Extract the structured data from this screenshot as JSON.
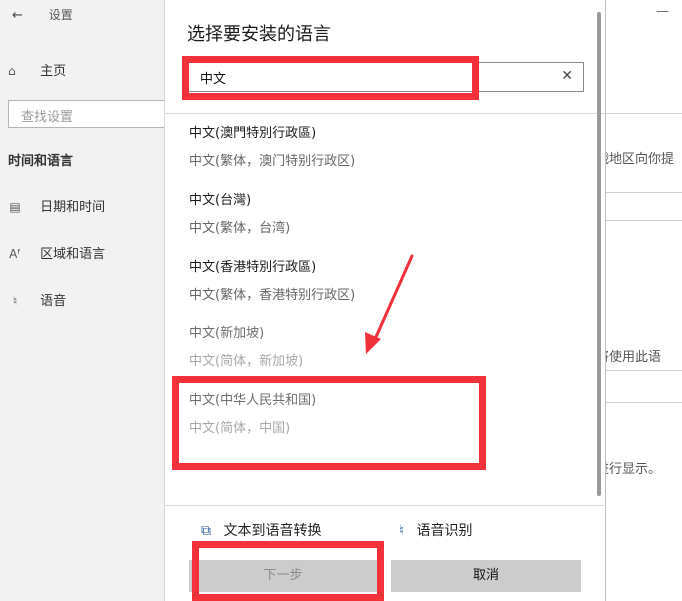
{
  "settings": {
    "back_glyph": "←",
    "title": "设置",
    "home_label": "主页",
    "search_placeholder": "查找设置",
    "section_title": "时间和语言",
    "items": [
      {
        "label": "日期和时间"
      },
      {
        "label": "区域和语言"
      },
      {
        "label": "语音"
      }
    ]
  },
  "background": {
    "fragment_1": "战地区向你提",
    "fragment_2": "将使用此语",
    "fragment_3": "进行显示。",
    "minimize_glyph": "—"
  },
  "dialog": {
    "title": "选择要安装的语言",
    "search_value": "中文",
    "clear_glyph": "✕",
    "languages": [
      {
        "name": "中文(澳門特別行政區)",
        "sub": "中文(繁体，澳门特别行政区)"
      },
      {
        "name": "中文(台灣)",
        "sub": "中文(繁体，台湾)"
      },
      {
        "name": "中文(香港特別行政區)",
        "sub": "中文(繁体，香港特别行政区)"
      },
      {
        "name": "中文(新加坡)",
        "sub": "中文(简体，新加坡)"
      },
      {
        "name": "中文(中华人民共和国)",
        "sub": "中文(简体，中国)"
      }
    ],
    "features": {
      "tts_label": "文本到语音转换",
      "speech_label": "语音识别"
    },
    "buttons": {
      "next_label": "下一步",
      "cancel_label": "取消"
    }
  },
  "annotation_color": "#f2323a"
}
